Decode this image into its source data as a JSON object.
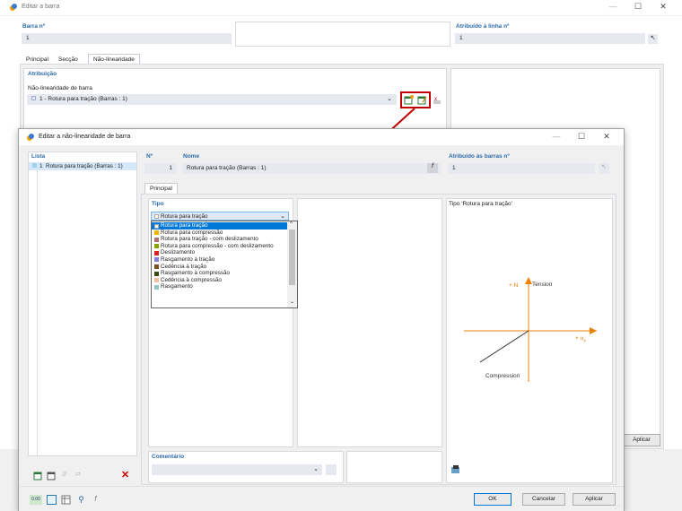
{
  "main_window": {
    "title": "Editar a barra",
    "member_no_label": "Barra nº",
    "member_no_value": "1",
    "assigned_line_label": "Atribuído à linha nº",
    "assigned_line_value": "1",
    "tabs": [
      "Principal",
      "Secção",
      "Não-linearidade"
    ],
    "active_tab": "Não-linearidade",
    "section_header": "Atribuição",
    "nonlinearity_label": "Não-linearidade de barra",
    "nonlinearity_value": "1 - Rotura para tração (Barras : 1)",
    "apply_label": "Aplicar"
  },
  "dialog": {
    "title": "Editar a não-linearidade de barra",
    "list_header": "Lista",
    "list_items": [
      {
        "no": "1",
        "label": "Rotura para tração (Barras : 1)"
      }
    ],
    "no_label": "Nº",
    "no_value": "1",
    "name_label": "Nome",
    "name_value": "Rotura para tração (Barras : 1)",
    "assigned_label": "Atribuído às barras nº",
    "assigned_value": "1",
    "tab_label": "Principal",
    "type_header": "Tipo",
    "type_selected": "Rotura para tração",
    "type_options": [
      {
        "label": "Rotura para tração",
        "color": "#ffffff"
      },
      {
        "label": "Rotura para compressão",
        "color": "#f0b400"
      },
      {
        "label": "Rotura para tração - com deslizamento",
        "color": "#b07070"
      },
      {
        "label": "Rotura para compressão - com deslizamento",
        "color": "#8aa000"
      },
      {
        "label": "Deslizamento",
        "color": "#e02020"
      },
      {
        "label": "Rasgamento à tração",
        "color": "#8080e0"
      },
      {
        "label": "Cedência à tração",
        "color": "#7a5020"
      },
      {
        "label": "Rasgamento à compressão",
        "color": "#3a4a10"
      },
      {
        "label": "Cedência à compressão",
        "color": "#f0c0a0"
      },
      {
        "label": "Rasgamento",
        "color": "#90c8c0"
      }
    ],
    "diagram_title": "Tipo 'Rotura para tração'",
    "diagram_tension": "Tension",
    "diagram_compression": "Compression",
    "diagram_n": "+ N",
    "diagram_ux": "+ u",
    "diagram_ux_sub": "x",
    "comment_header": "Comentário",
    "ok_label": "OK",
    "cancel_label": "Cancelar",
    "apply_label": "Aplicar"
  },
  "colors": {
    "accent_blue": "#0078d7",
    "header_blue": "#2a6aa8",
    "arrow_red": "#c00000",
    "diagram_orange": "#f08000"
  }
}
